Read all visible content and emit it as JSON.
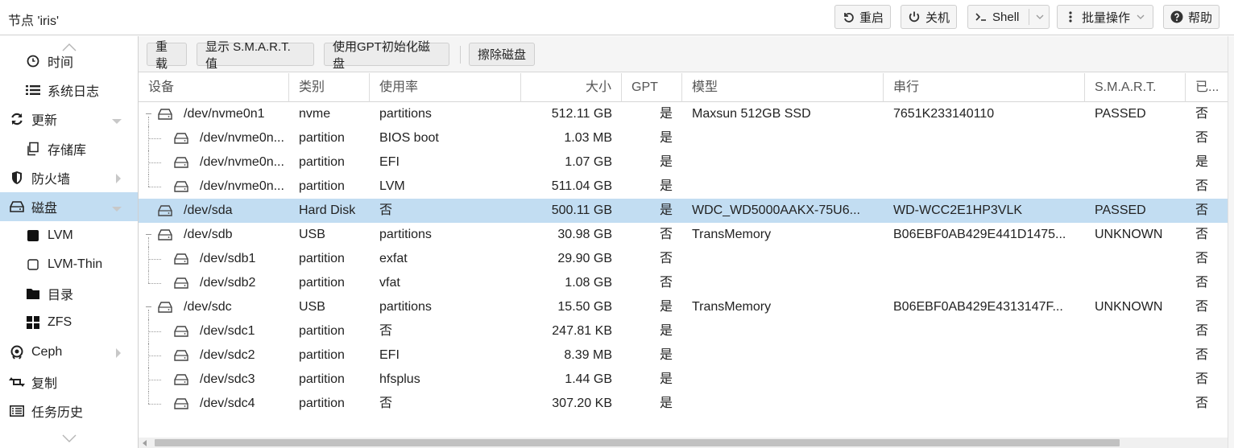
{
  "header": {
    "node_title": "节点 'iris'",
    "buttons": {
      "reboot": "重启",
      "shutdown": "关机",
      "shell": "Shell",
      "bulk": "批量操作",
      "help": "帮助"
    }
  },
  "sidebar": {
    "items": [
      {
        "label": "时间",
        "icon": "clock-icon"
      },
      {
        "label": "系统日志",
        "icon": "list-icon"
      },
      {
        "label": "更新",
        "icon": "refresh-icon"
      },
      {
        "label": "存储库",
        "icon": "copy-icon"
      },
      {
        "label": "防火墙",
        "icon": "shield-icon"
      },
      {
        "label": "磁盘",
        "icon": "hdd-icon"
      },
      {
        "label": "LVM",
        "icon": "square-icon"
      },
      {
        "label": "LVM-Thin",
        "icon": "square-outline-icon"
      },
      {
        "label": "目录",
        "icon": "folder-icon"
      },
      {
        "label": "ZFS",
        "icon": "grid-icon"
      },
      {
        "label": "Ceph",
        "icon": "ceph-icon"
      },
      {
        "label": "复制",
        "icon": "retweet-icon"
      },
      {
        "label": "任务历史",
        "icon": "tasks-icon"
      }
    ]
  },
  "toolbar": {
    "reload": "重载",
    "show_smart": "显示 S.M.A.R.T. 值",
    "init_gpt": "使用GPT初始化磁盘",
    "wipe": "擦除磁盘"
  },
  "grid": {
    "columns": [
      "设备",
      "类别",
      "使用率",
      "大小",
      "GPT",
      "模型",
      "串行",
      "S.M.A.R.T.",
      "已..."
    ],
    "rows": [
      {
        "level": 0,
        "device": "/dev/nvme0n1",
        "type": "nvme",
        "usage": "partitions",
        "size": "512.11 GB",
        "gpt": "是",
        "model": "Maxsun 512GB SSD",
        "serial": "7651K233140110",
        "smart": "PASSED",
        "mounted": "否"
      },
      {
        "level": 1,
        "device": "/dev/nvme0n...",
        "type": "partition",
        "usage": "BIOS boot",
        "size": "1.03 MB",
        "gpt": "是",
        "model": "",
        "serial": "",
        "smart": "",
        "mounted": "否"
      },
      {
        "level": 1,
        "device": "/dev/nvme0n...",
        "type": "partition",
        "usage": "EFI",
        "size": "1.07 GB",
        "gpt": "是",
        "model": "",
        "serial": "",
        "smart": "",
        "mounted": "是"
      },
      {
        "level": 1,
        "device": "/dev/nvme0n...",
        "type": "partition",
        "usage": "LVM",
        "size": "511.04 GB",
        "gpt": "是",
        "model": "",
        "serial": "",
        "smart": "",
        "mounted": "否"
      },
      {
        "level": 0,
        "device": "/dev/sda",
        "type": "Hard Disk",
        "usage": "否",
        "size": "500.11 GB",
        "gpt": "是",
        "model": "WDC_WD5000AAKX-75U6...",
        "serial": "WD-WCC2E1HP3VLK",
        "smart": "PASSED",
        "mounted": "否",
        "selected": true
      },
      {
        "level": 0,
        "device": "/dev/sdb",
        "type": "USB",
        "usage": "partitions",
        "size": "30.98 GB",
        "gpt": "否",
        "model": "TransMemory",
        "serial": "B06EBF0AB429E441D1475...",
        "smart": "UNKNOWN",
        "mounted": "否"
      },
      {
        "level": 1,
        "device": "/dev/sdb1",
        "type": "partition",
        "usage": "exfat",
        "size": "29.90 GB",
        "gpt": "否",
        "model": "",
        "serial": "",
        "smart": "",
        "mounted": "否"
      },
      {
        "level": 1,
        "device": "/dev/sdb2",
        "type": "partition",
        "usage": "vfat",
        "size": "1.08 GB",
        "gpt": "否",
        "model": "",
        "serial": "",
        "smart": "",
        "mounted": "否"
      },
      {
        "level": 0,
        "device": "/dev/sdc",
        "type": "USB",
        "usage": "partitions",
        "size": "15.50 GB",
        "gpt": "是",
        "model": "TransMemory",
        "serial": "B06EBF0AB429E4313147F...",
        "smart": "UNKNOWN",
        "mounted": "否"
      },
      {
        "level": 1,
        "device": "/dev/sdc1",
        "type": "partition",
        "usage": "否",
        "size": "247.81 KB",
        "gpt": "是",
        "model": "",
        "serial": "",
        "smart": "",
        "mounted": "否"
      },
      {
        "level": 1,
        "device": "/dev/sdc2",
        "type": "partition",
        "usage": "EFI",
        "size": "8.39 MB",
        "gpt": "是",
        "model": "",
        "serial": "",
        "smart": "",
        "mounted": "否"
      },
      {
        "level": 1,
        "device": "/dev/sdc3",
        "type": "partition",
        "usage": "hfsplus",
        "size": "1.44 GB",
        "gpt": "是",
        "model": "",
        "serial": "",
        "smart": "",
        "mounted": "否"
      },
      {
        "level": 1,
        "device": "/dev/sdc4",
        "type": "partition",
        "usage": "否",
        "size": "307.20 KB",
        "gpt": "是",
        "model": "",
        "serial": "",
        "smart": "",
        "mounted": "否"
      }
    ]
  },
  "colors": {
    "selected_row": "#c2ddf2",
    "toolbar_bg": "#f5f5f5"
  }
}
